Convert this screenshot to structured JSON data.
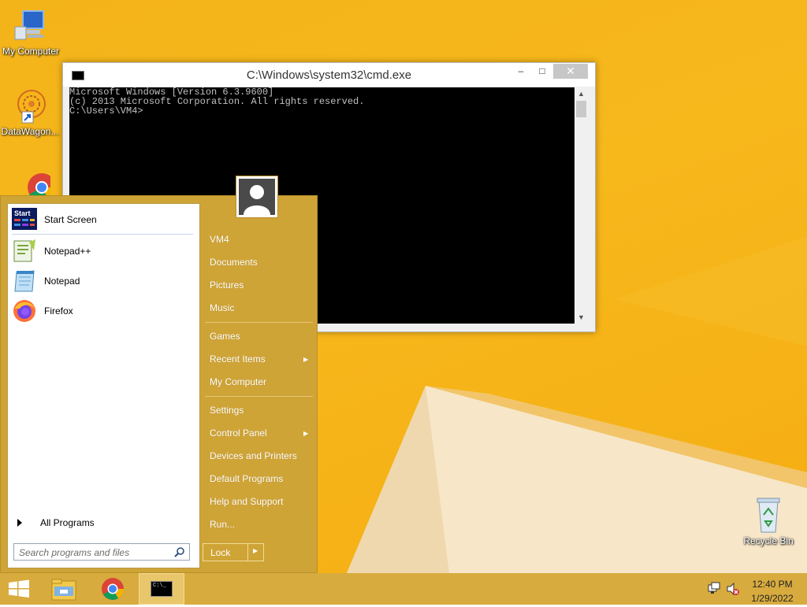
{
  "desktop": {
    "icons": [
      {
        "label": "My Computer",
        "icon": "monitor-icon"
      },
      {
        "label": "DataWagon...",
        "icon": "datawagon-shortcut-icon"
      },
      {
        "label": "",
        "icon": "chrome-icon"
      },
      {
        "label": "Recycle Bin",
        "icon": "recycle-bin-icon"
      }
    ]
  },
  "cmd": {
    "title": "C:\\Windows\\system32\\cmd.exe",
    "minimize": "–",
    "maximize": "□",
    "close": "✕",
    "lines": [
      "Microsoft Windows [Version 6.3.9600]",
      "(c) 2013 Microsoft Corporation. All rights reserved.",
      "",
      "C:\\Users\\VM4>"
    ],
    "scroll_up": "▲",
    "scroll_down": "▼"
  },
  "start_menu": {
    "pinned": [
      {
        "label": "Start Screen",
        "icon": "start-screen-icon",
        "badge": "Start"
      },
      {
        "label": "Notepad++",
        "icon": "notepad-plus-plus-icon"
      },
      {
        "label": "Notepad",
        "icon": "notepad-icon"
      },
      {
        "label": "Firefox",
        "icon": "firefox-icon"
      }
    ],
    "all_programs": "All Programs",
    "search_placeholder": "Search programs and files",
    "right_links": [
      {
        "label": "VM4"
      },
      {
        "label": "Documents"
      },
      {
        "label": "Pictures"
      },
      {
        "label": "Music"
      },
      {
        "label": "Games"
      },
      {
        "label": "Recent Items",
        "submenu": "▶"
      },
      {
        "label": "My Computer"
      },
      {
        "label": "Settings"
      },
      {
        "label": "Control Panel",
        "submenu": "▶"
      },
      {
        "label": "Devices and Printers"
      },
      {
        "label": "Default Programs"
      },
      {
        "label": "Help and Support"
      },
      {
        "label": "Run..."
      }
    ],
    "lock": "Lock",
    "lock_arrow": "▶"
  },
  "taskbar": {
    "items": [
      "start-button",
      "file-explorer",
      "chrome",
      "cmd"
    ],
    "cmd_glyph": "C:\\_",
    "time": "12:40 PM",
    "date": "1/29/2022"
  },
  "colors": {
    "desktop": "#f5b418",
    "start_menu": "#cfa436",
    "taskbar": "#d7ab3e",
    "console_bg": "#000000",
    "console_fg": "#c0c0c0"
  }
}
